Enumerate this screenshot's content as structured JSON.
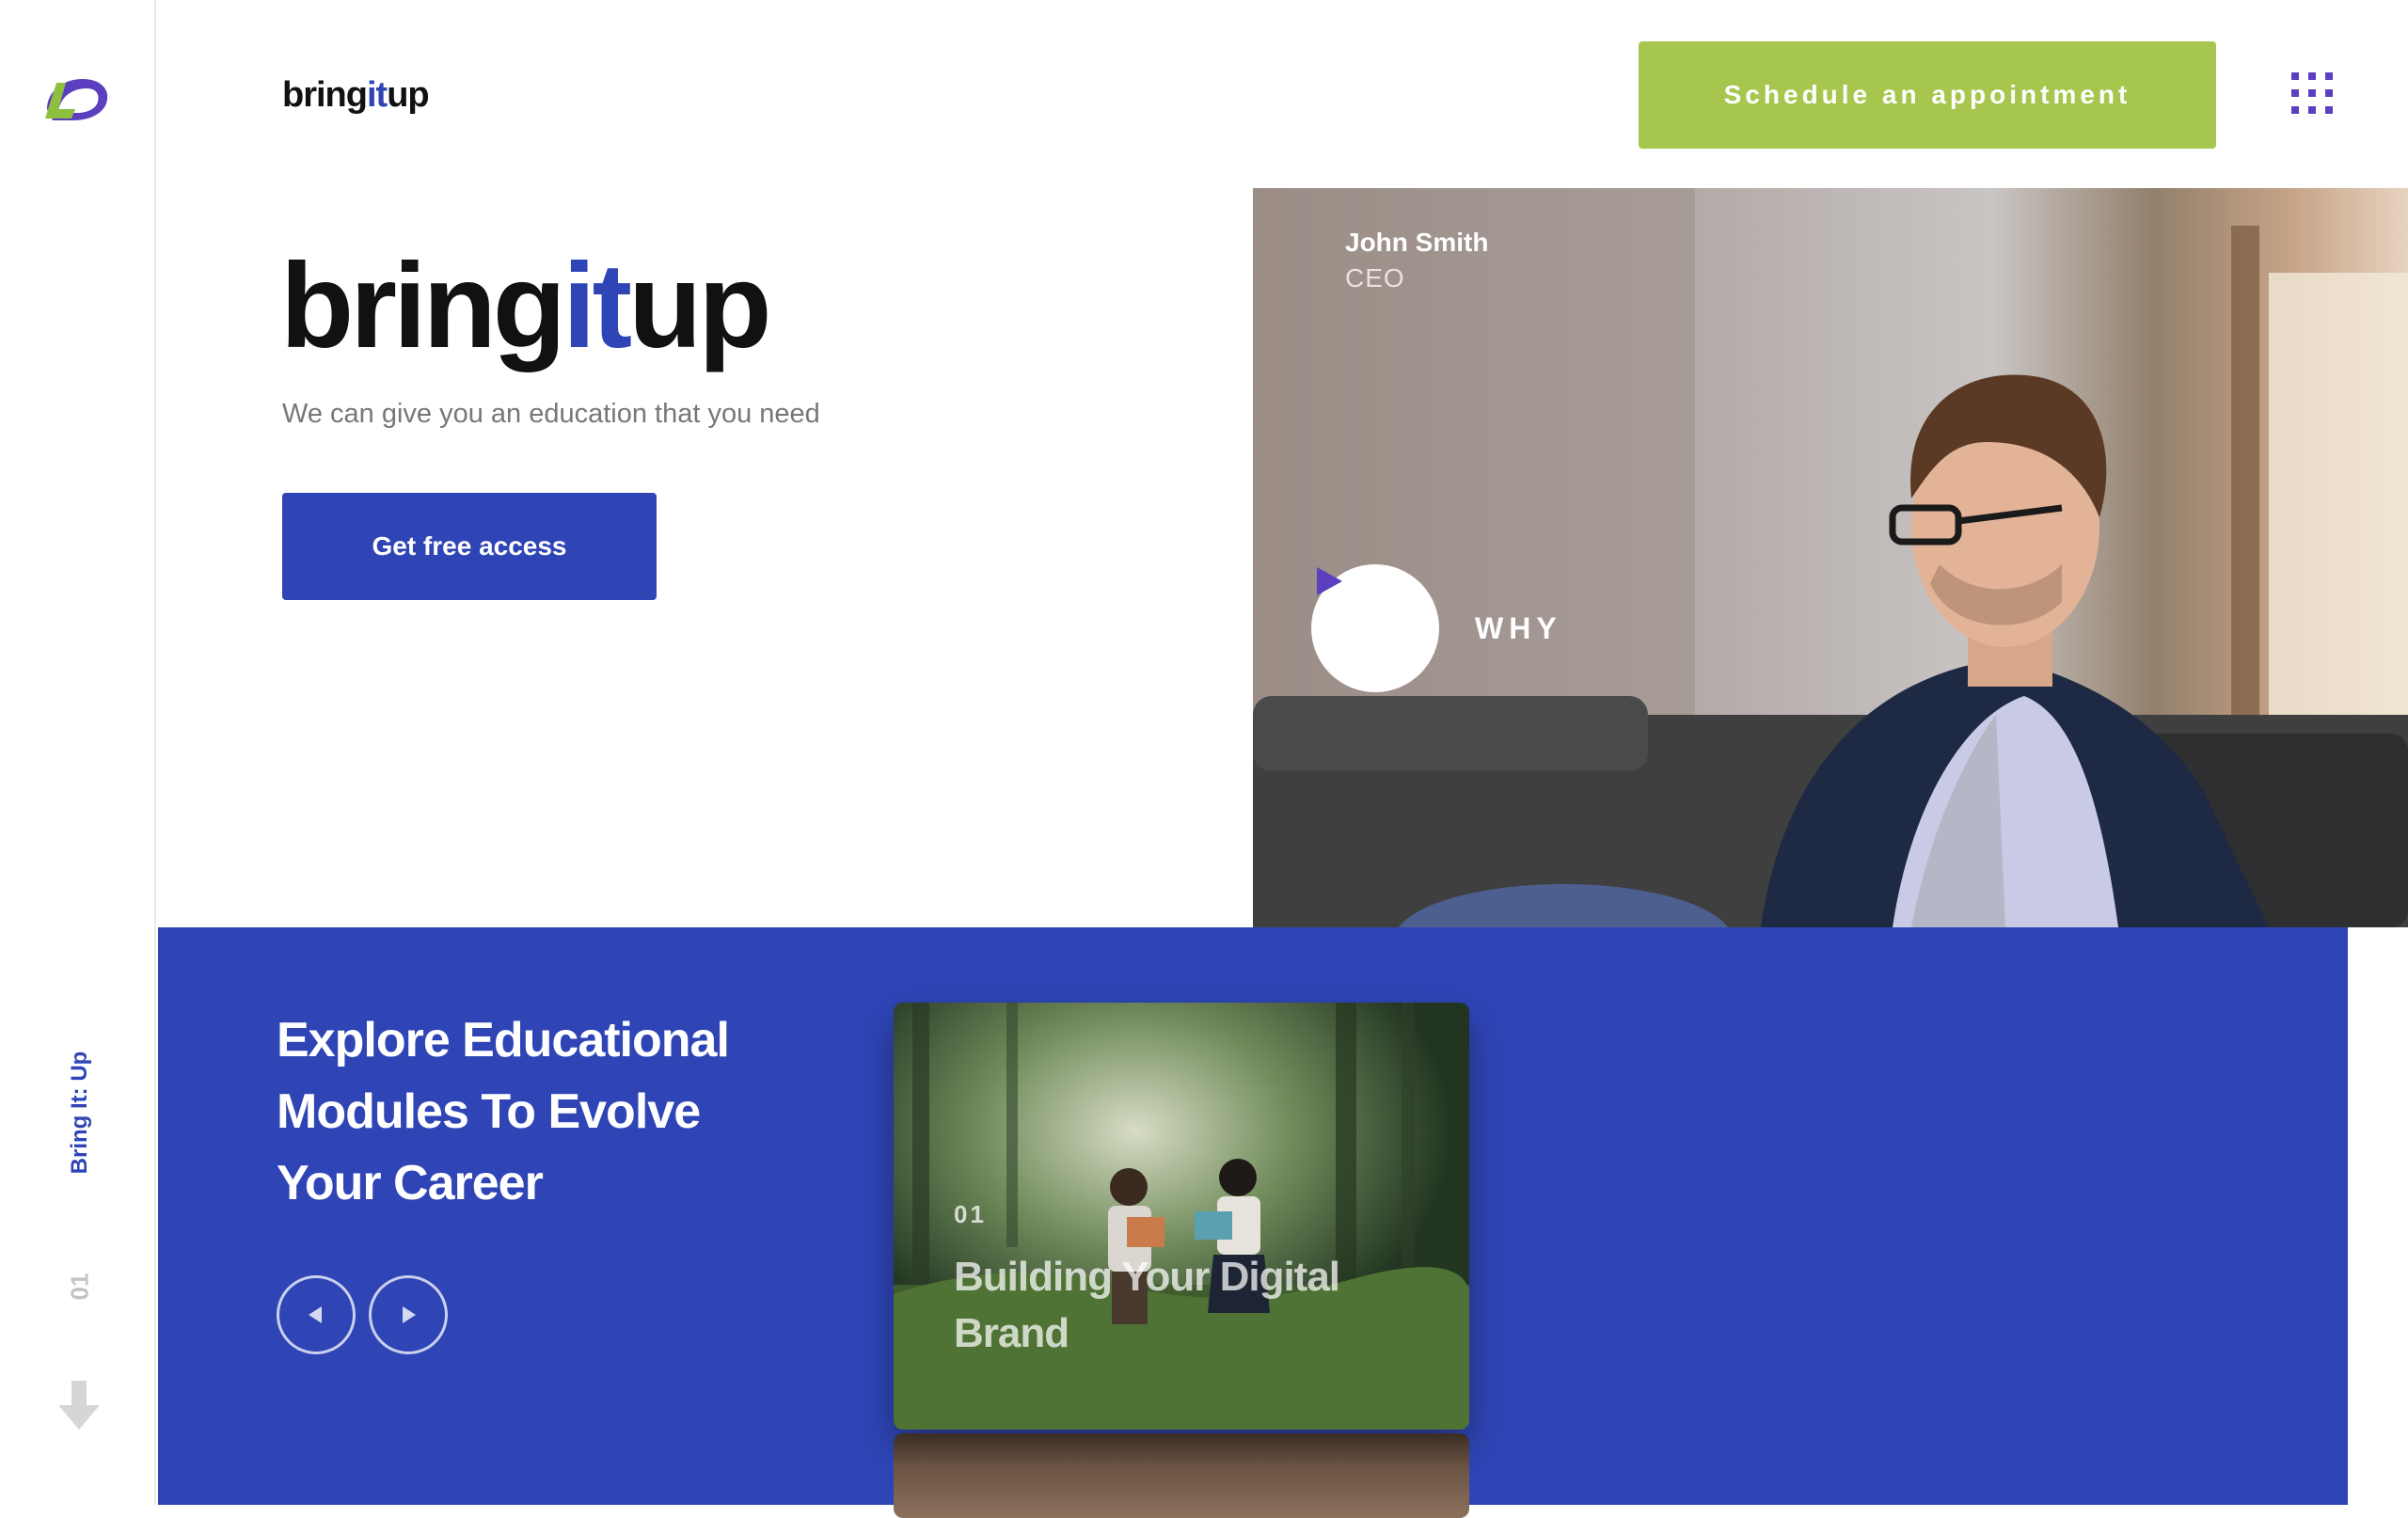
{
  "sidebar": {
    "vertical_label": "Bring It: Up",
    "slide_number": "01",
    "logo_icon": "bringitup-logo-icon",
    "scroll_icon": "arrow-down-icon"
  },
  "header": {
    "brand_prefix": "bring",
    "brand_accent": "it",
    "brand_suffix": "up",
    "cta_label": "Schedule an appointment",
    "menu_icon": "grid-menu-icon"
  },
  "hero": {
    "brand_prefix": "bring",
    "brand_accent": "it",
    "brand_suffix": "up",
    "tagline": "We can give you an education that you need",
    "cta_label": "Get free access"
  },
  "video": {
    "person_name": "John Smith",
    "person_role": "CEO",
    "play_label": "WHY",
    "play_icon": "play-icon"
  },
  "modules": {
    "title_line1": "Explore Educational",
    "title_line2": "Modules To Evolve",
    "title_line3": "Your Career",
    "prev_icon": "arrow-left-icon",
    "next_icon": "arrow-right-icon",
    "cards": [
      {
        "number": "01",
        "title": "Building Your Digital Brand"
      }
    ]
  },
  "colors": {
    "brand_blue": "#2f45b6",
    "accent_green": "#a6c64e",
    "menu_purple": "#5b3fbf"
  }
}
